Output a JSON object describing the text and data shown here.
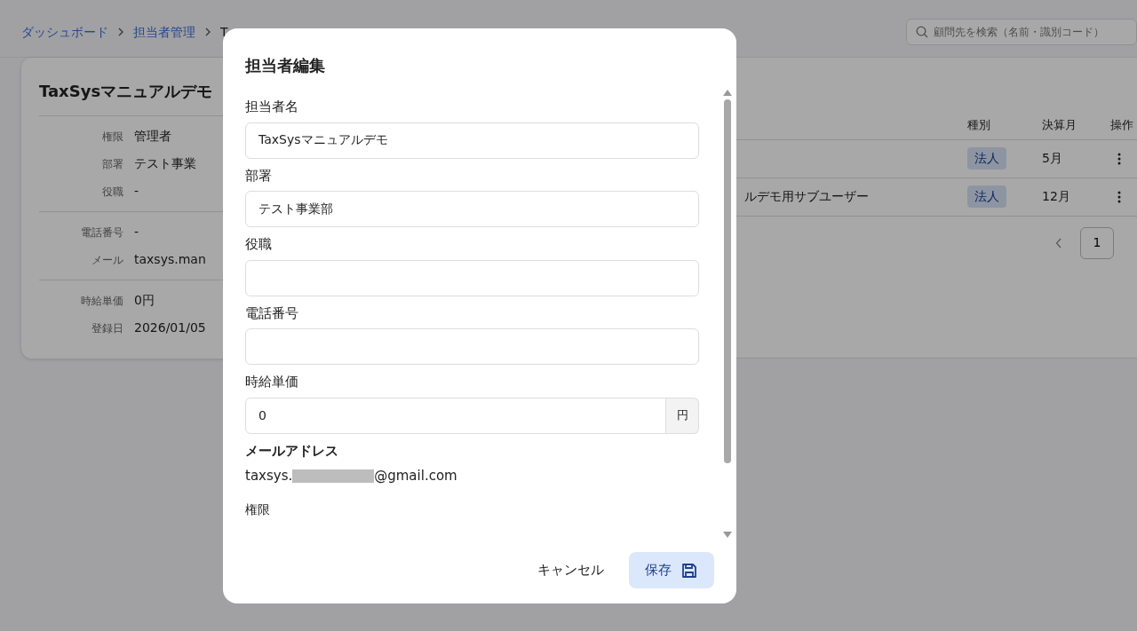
{
  "breadcrumb": [
    {
      "label": "ダッシュボード",
      "link": true
    },
    {
      "label": "担当者管理",
      "link": true
    },
    {
      "label": "T",
      "link": false
    }
  ],
  "search": {
    "placeholder": "顧問先を検索（名前・識別コード）"
  },
  "profile_card": {
    "name": "TaxSysマニュアルデモ",
    "groups": [
      [
        {
          "label": "権限",
          "value": "管理者"
        },
        {
          "label": "部署",
          "value": "テスト事業"
        },
        {
          "label": "役職",
          "value": "-"
        }
      ],
      [
        {
          "label": "電話番号",
          "value": "-"
        },
        {
          "label": "メール",
          "value": "taxsys.man"
        }
      ],
      [
        {
          "label": "時給単価",
          "value": "0円"
        },
        {
          "label": "登録日",
          "value": "2026/01/05"
        }
      ]
    ]
  },
  "clients_table": {
    "columns": [
      {
        "label": "種別"
      },
      {
        "label": "決算月"
      },
      {
        "label": "操作"
      }
    ],
    "rows": [
      {
        "type": "法人",
        "month": "5月"
      },
      {
        "name": "ルデモ用サブユーザー",
        "type": "法人",
        "month": "12月"
      }
    ],
    "pages": [
      {
        "label": "1",
        "selected": true
      }
    ]
  },
  "modal": {
    "title": "担当者編集",
    "fields": [
      {
        "label": "担当者名",
        "kind": "input",
        "value": "TaxSysマニュアルデモ"
      },
      {
        "label": "部署",
        "kind": "input",
        "value": "テスト事業部"
      },
      {
        "label": "役職",
        "kind": "input"
      },
      {
        "label": "電話番号",
        "kind": "input"
      },
      {
        "label": "時給単価",
        "kind": "input",
        "value": "0",
        "suffix": "円"
      },
      {
        "label": "メールアドレス",
        "kind": "static",
        "value_prefix": "taxsys.",
        "redacted": true,
        "value_suffix": "@gmail.com"
      },
      {
        "label": "権限",
        "kind": "section"
      }
    ],
    "buttons": [
      {
        "label": "キャンセル",
        "kind": "text"
      },
      {
        "label": "保存",
        "kind": "primary"
      }
    ]
  }
}
